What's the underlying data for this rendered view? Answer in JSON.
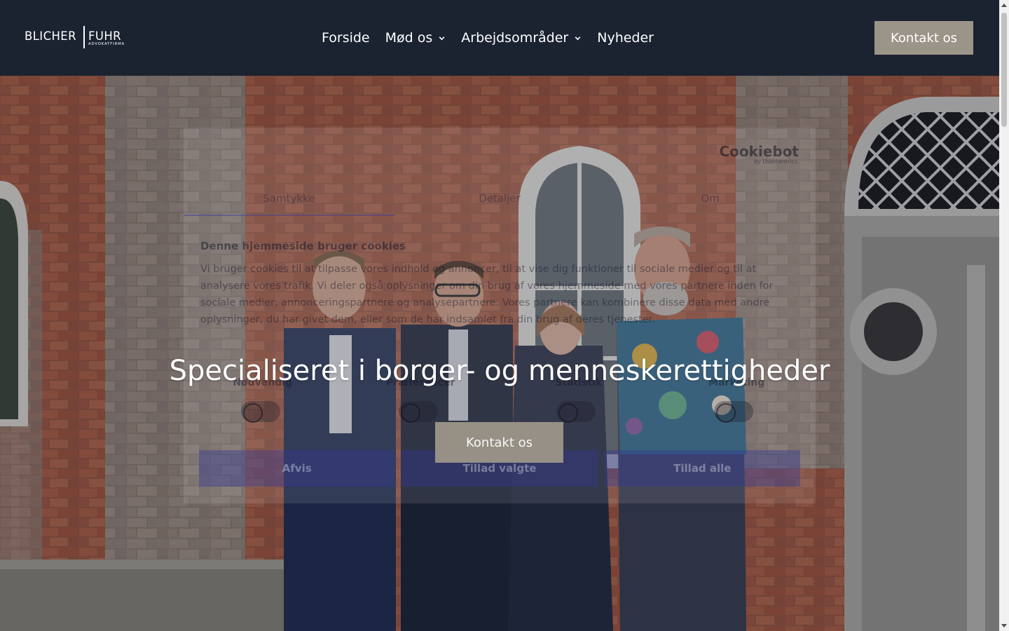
{
  "logo": {
    "left": "BLICHER",
    "right": "FUHR",
    "sub": "ADVOKATFIRMA"
  },
  "nav": {
    "items": [
      {
        "label": "Forside",
        "dropdown": false
      },
      {
        "label": "Mød os",
        "dropdown": true
      },
      {
        "label": "Arbejdsområder",
        "dropdown": true
      },
      {
        "label": "Nyheder",
        "dropdown": false
      }
    ],
    "cta": "Kontakt os"
  },
  "hero": {
    "title": "Specialiseret i borger- og menneskerettigheder",
    "cta": "Kontakt os"
  },
  "cookie_banner": {
    "brand": "Cookiebot",
    "brand_sub": "by Usercentrics",
    "tabs": [
      "Samtykke",
      "Detaljer",
      "Om"
    ],
    "heading": "Denne hjemmeside bruger cookies",
    "body": "Vi bruger cookies til at tilpasse vores indhold og annoncer, til at vise dig funktioner til sociale medier og til at analysere vores trafik. Vi deler også oplysninger om din brug af vores hjemmeside med vores partnere inden for sociale medier, annonceringspartnere og analysepartnere. Vores partnere kan kombinere disse data med andre oplysninger, du har givet dem, eller som de har indsamlet fra din brug af deres tjenester.",
    "categories": [
      "Nødvendig",
      "Præferencer",
      "Statistik",
      "Marketing"
    ],
    "buttons": [
      "Afvis",
      "Tillad valgte",
      "Tillad alle"
    ]
  },
  "colors": {
    "header_bg": "#1b2230",
    "cta_bg": "#9b9488",
    "text": "#ffffff"
  },
  "icons": {
    "dropdown": "chevron-down-icon"
  }
}
